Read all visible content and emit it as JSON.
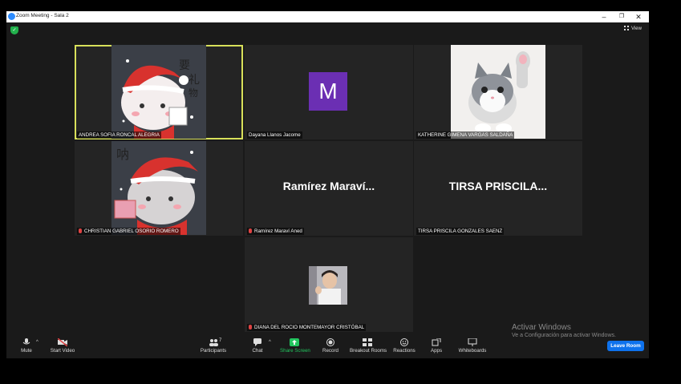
{
  "window": {
    "title": "Zoom Meeting - Sala 2",
    "minimize": "–",
    "maximize": "❐",
    "close": "✕"
  },
  "view_label": "View",
  "participants_tiles": [
    {
      "name": "ANDREA SOFIA RONCAL ALEGRIA"
    },
    {
      "name": "Dayana Llanos Jacome",
      "avatar_letter": "M"
    },
    {
      "name": "KATHERINE GIMENA VARGAS SALDAÑA"
    },
    {
      "name": "CHRISTIAN GABRIEL OSORIO ROMERO"
    },
    {
      "name": "Ramírez Maraví Aned",
      "display": "Ramírez  Maraví..."
    },
    {
      "name": "TIRSA PRISCILA GONZALES SAENZ",
      "display": "TIRSA  PRISCILA..."
    },
    {
      "name": "DIANA DEL ROCIO MONTEMAYOR CRISTÓBAL"
    }
  ],
  "toolbar": {
    "mute": "Mute",
    "start_video": "Start Video",
    "participants": "Participants",
    "participants_count": "7",
    "chat": "Chat",
    "share_screen": "Share Screen",
    "record": "Record",
    "breakout_rooms": "Breakout Rooms",
    "reactions": "Reactions",
    "apps": "Apps",
    "whiteboards": "Whiteboards",
    "leave_room": "Leave Room"
  },
  "watermark": {
    "line1": "Activar Windows",
    "line2": "Ve a Configuración para activar Windows."
  },
  "colors": {
    "active_speaker": "#d8e05a",
    "share_green": "#22c55e",
    "leave_blue": "#0e72ed",
    "avatar_purple": "#6b2fb3"
  }
}
